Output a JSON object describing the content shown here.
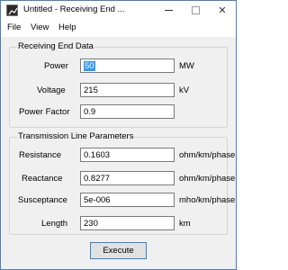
{
  "window": {
    "title": "Untitled - Receiving End ...",
    "icon": "chart-app-icon"
  },
  "menu": {
    "file": "File",
    "view": "View",
    "help": "Help"
  },
  "receiving_end": {
    "title": "Receiving End Data",
    "power": {
      "label": "Power",
      "value": "50",
      "unit": "MW"
    },
    "voltage": {
      "label": "Voltage",
      "value": "215",
      "unit": "kV"
    },
    "power_factor": {
      "label": "Power Factor",
      "value": "0.9"
    }
  },
  "line_params": {
    "title": "Transmission Line Parameters",
    "resistance": {
      "label": "Resistance",
      "value": "0.1603",
      "unit": "ohm/km/phase"
    },
    "reactance": {
      "label": "Reactance",
      "value": "0.8277",
      "unit": "ohm/km/phase"
    },
    "susceptance": {
      "label": "Susceptance",
      "value": "5e-006",
      "unit": "mho/km/phase"
    },
    "length": {
      "label": "Length",
      "value": "230",
      "unit": "km"
    }
  },
  "actions": {
    "execute": "Execute"
  },
  "colors": {
    "selection": "#3399ff",
    "button_border": "#2f86d8",
    "window_border": "#4a7fbf"
  }
}
